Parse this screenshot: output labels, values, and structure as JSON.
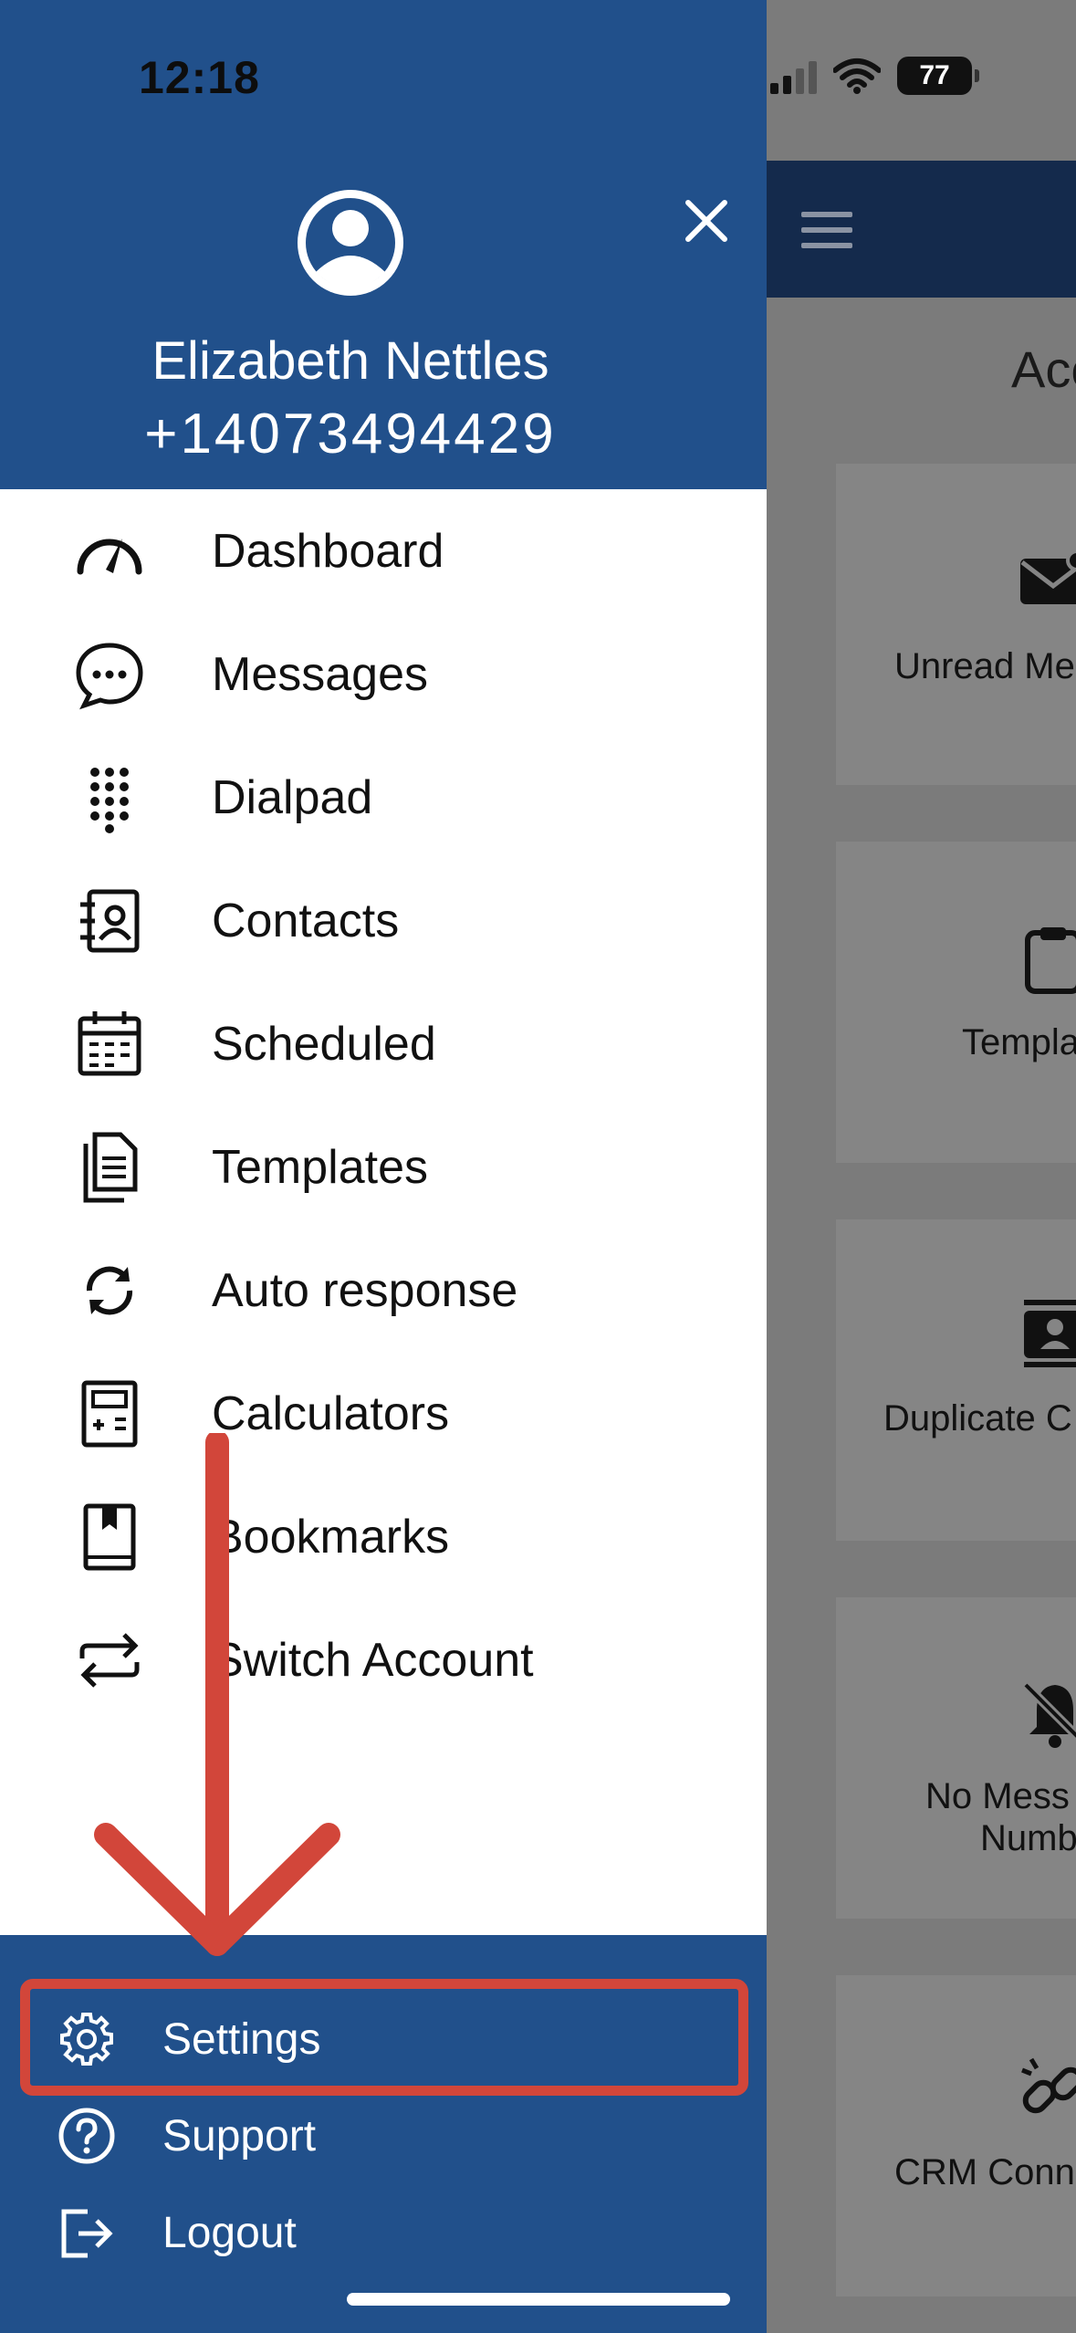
{
  "status_bar": {
    "time": "12:18",
    "battery": "77"
  },
  "drawer": {
    "user": {
      "name": "Elizabeth Nettles",
      "phone": "+14073494429"
    },
    "menu": [
      {
        "label": "Dashboard",
        "icon": "speedometer-icon"
      },
      {
        "label": "Messages",
        "icon": "chat-bubble-icon"
      },
      {
        "label": "Dialpad",
        "icon": "dialpad-icon"
      },
      {
        "label": "Contacts",
        "icon": "contacts-book-icon"
      },
      {
        "label": "Scheduled",
        "icon": "calendar-icon"
      },
      {
        "label": "Templates",
        "icon": "documents-icon"
      },
      {
        "label": "Auto response",
        "icon": "refresh-icon"
      },
      {
        "label": "Calculators",
        "icon": "calculator-icon"
      },
      {
        "label": "Bookmarks",
        "icon": "bookmark-book-icon"
      },
      {
        "label": "Switch Account",
        "icon": "switch-arrows-icon"
      }
    ],
    "footer": [
      {
        "label": "Settings",
        "icon": "gear-icon"
      },
      {
        "label": "Support",
        "icon": "help-circle-icon"
      },
      {
        "label": "Logout",
        "icon": "logout-icon"
      }
    ]
  },
  "background": {
    "title": "Acc",
    "cards": [
      {
        "label": "Unread Me",
        "icon": "mail-icon"
      },
      {
        "label": "Templa",
        "icon": "clipboard-icon"
      },
      {
        "label": "Duplicate C",
        "icon": "contact-card-icon"
      },
      {
        "label_line1": "No Mess",
        "label_line2": "Numb",
        "icon": "bell-off-icon"
      },
      {
        "label": "CRM Conn",
        "icon": "unlink-icon"
      }
    ]
  },
  "colors": {
    "drawer_blue": "#21508b",
    "highlight_red": "#d2463a",
    "header_dark": "#142a4c"
  }
}
